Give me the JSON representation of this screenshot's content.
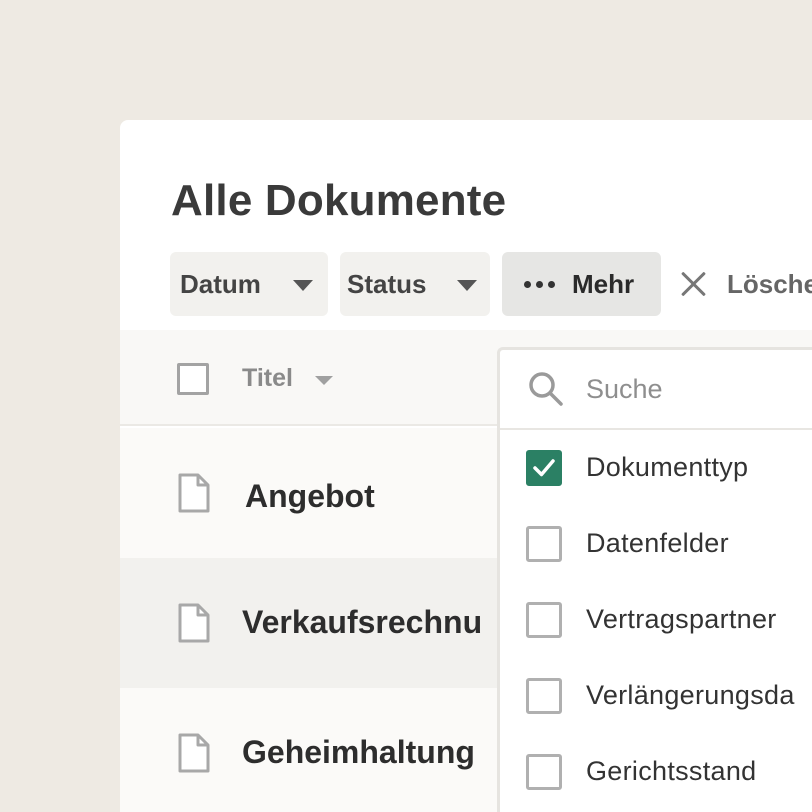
{
  "page": {
    "title": "Alle Dokumente"
  },
  "filters": {
    "date_label": "Datum",
    "status_label": "Status",
    "more_label": "Mehr",
    "clear_label": "Lösche"
  },
  "table": {
    "column_title": "Titel",
    "rows": [
      {
        "title": "Angebot"
      },
      {
        "title": "Verkaufsrechnu"
      },
      {
        "title": "Geheimhaltung"
      }
    ]
  },
  "dropdown": {
    "search_placeholder": "Suche",
    "options": [
      {
        "label": "Dokumenttyp",
        "checked": true
      },
      {
        "label": "Datenfelder",
        "checked": false
      },
      {
        "label": "Vertragspartner",
        "checked": false
      },
      {
        "label": "Verlängerungsda",
        "checked": false
      },
      {
        "label": "Gerichtsstand",
        "checked": false
      }
    ]
  },
  "colors": {
    "background": "#eeeae3",
    "checked_accent": "#2b8064"
  }
}
